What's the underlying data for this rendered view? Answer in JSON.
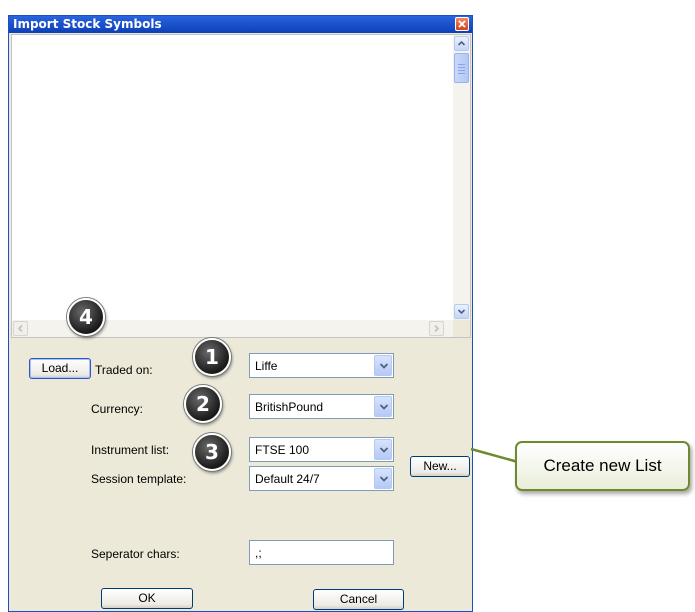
{
  "window": {
    "title": "Import Stock Symbols",
    "close_icon": "close-icon"
  },
  "buttons": {
    "load": "Load...",
    "new": "New...",
    "ok": "OK",
    "cancel": "Cancel"
  },
  "fields": {
    "traded_on": {
      "label": "Traded on:",
      "value": "Liffe"
    },
    "currency": {
      "label": "Currency:",
      "value": "BritishPound"
    },
    "instrument_list": {
      "label": "Instrument list:",
      "value": "FTSE 100"
    },
    "session_template": {
      "label": "Session template:",
      "value": "Default 24/7"
    },
    "separator_chars": {
      "label": "Seperator chars:",
      "value": ",;"
    }
  },
  "badges": [
    "1",
    "2",
    "3",
    "4"
  ],
  "callout": {
    "text": "Create new List"
  },
  "colors": {
    "titlebar": "#0c3fb8",
    "callout_border": "#6e8a2e",
    "badge": "#1f1f1f"
  }
}
